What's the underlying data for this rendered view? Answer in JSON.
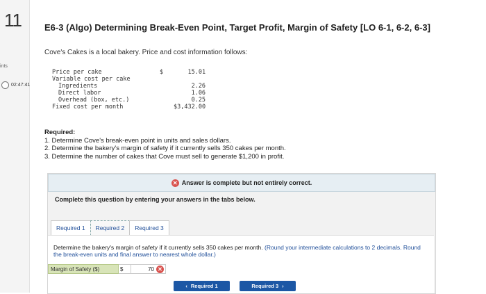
{
  "question_number": "11",
  "sidebar": {
    "points_label": "ints",
    "timer": "02:47:41"
  },
  "title": "E6-3 (Algo) Determining Break-Even Point, Target Profit, Margin of Safety [LO 6-1, 6-2, 6-3]",
  "intro": "Cove's Cakes is a local bakery. Price and cost information follows:",
  "cost_table": [
    {
      "label": "Price per cake",
      "currency": "$",
      "value": "15.01"
    },
    {
      "label": "Variable cost per cake",
      "currency": "",
      "value": ""
    },
    {
      "label": "  Ingredients",
      "currency": "",
      "value": "2.26"
    },
    {
      "label": "  Direct labor",
      "currency": "",
      "value": "1.06"
    },
    {
      "label": "  Overhead (box, etc.)",
      "currency": "",
      "value": "0.25"
    },
    {
      "label": "Fixed cost per month",
      "currency": "",
      "value": "$3,432.00"
    }
  ],
  "required": {
    "heading": "Required:",
    "items": [
      "1. Determine Cove's break-even point in units and sales dollars.",
      "2. Determine the bakery's margin of safety if it currently sells 350 cakes per month.",
      "3. Determine the number of cakes that Cove must sell to generate $1,200 in profit."
    ]
  },
  "status": {
    "text": "Answer is complete but not entirely correct.",
    "icon": "x-circle-icon",
    "color": "#d9534f"
  },
  "instruction": "Complete this question by entering your answers in the tabs below.",
  "tabs": [
    {
      "label": "Required 1"
    },
    {
      "label": "Required 2"
    },
    {
      "label": "Required 3"
    }
  ],
  "active_tab": "Required 2",
  "question_text": "Determine the bakery's margin of safety if it currently sells 350 cakes per month.",
  "question_note": "(Round your intermediate calculations to 2 decimals. Round the break-even units and final answer to nearest whole dollar.)",
  "answer": {
    "label": "Margin of Safety ($)",
    "currency": "$",
    "value": "70"
  },
  "nav": {
    "prev": "Required 1",
    "next": "Required 3"
  },
  "colors": {
    "accent": "#1c57a5",
    "wrong": "#d9534f",
    "answer_label_bg": "#d8e4b8"
  }
}
